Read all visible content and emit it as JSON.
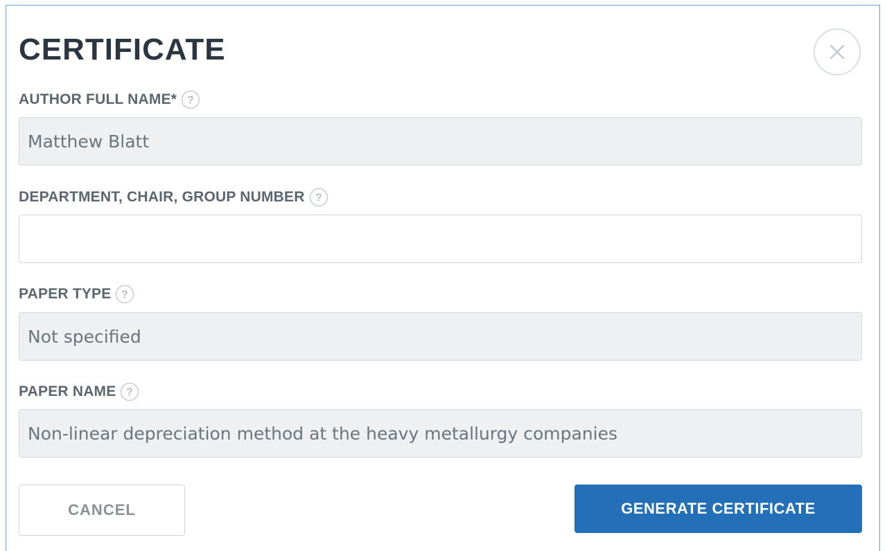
{
  "dialog": {
    "title": "CERTIFICATE",
    "close_icon": "close-icon"
  },
  "fields": [
    {
      "label": "AUTHOR FULL NAME*",
      "value": "Matthew Blatt",
      "help_icon": "question-circle-icon",
      "readonly": true
    },
    {
      "label": "DEPARTMENT, CHAIR, GROUP NUMBER",
      "value": "",
      "placeholder": "",
      "help_icon": "question-circle-icon",
      "readonly": false
    },
    {
      "label": "PAPER TYPE",
      "value": "Not specified",
      "help_icon": "question-circle-icon",
      "readonly": true
    },
    {
      "label": "PAPER NAME",
      "value": "Non-linear depreciation method at the heavy metallurgy companies",
      "help_icon": "question-circle-icon",
      "readonly": true
    }
  ],
  "buttons": {
    "cancel_label": "CANCEL",
    "generate_label": "GENERATE CERTIFICATE"
  },
  "colors": {
    "border_accent": "#6a9fd2",
    "primary_button": "#2470b8",
    "title_text": "#2b3640",
    "label_text": "#5c6670",
    "readonly_bg": "#eef0f1"
  }
}
